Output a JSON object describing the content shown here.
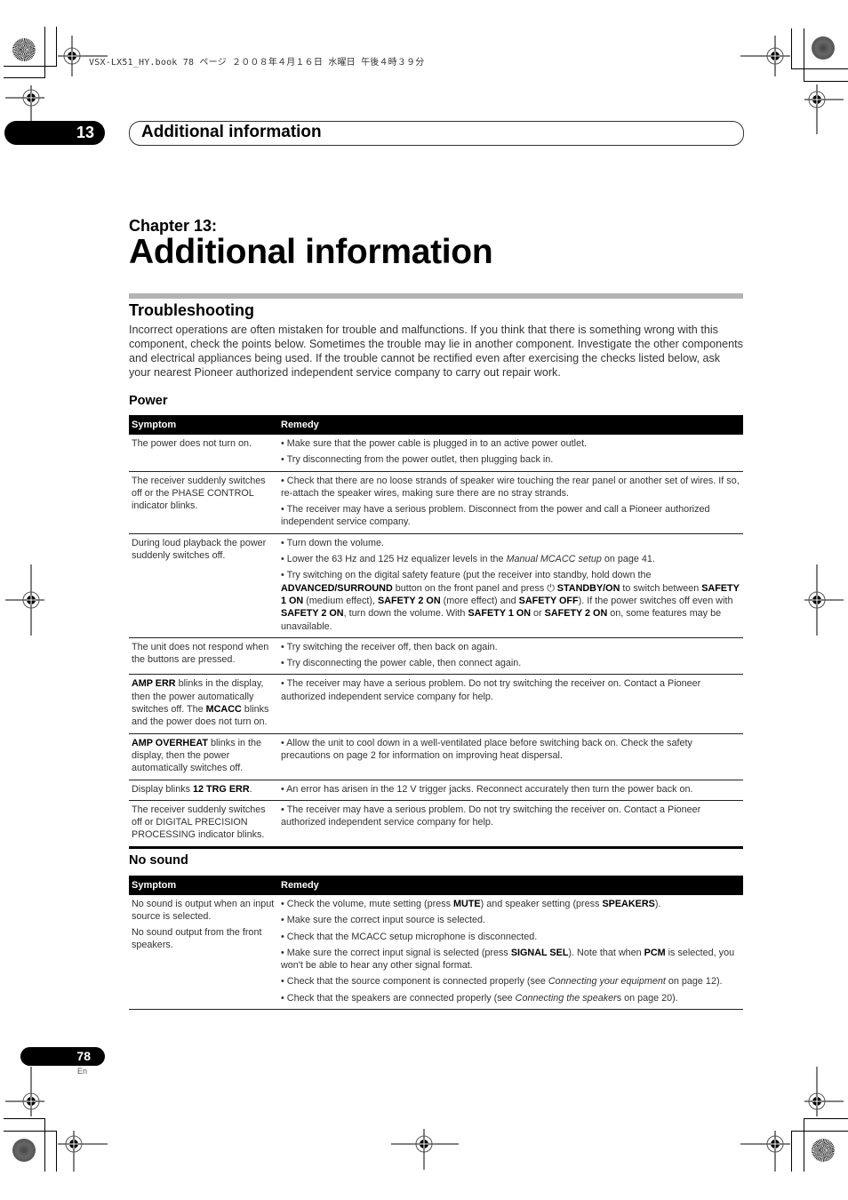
{
  "file_meta": "VSX-LX51_HY.book  78 ページ  ２００８年４月１６日  水曜日  午後４時３９分",
  "header": {
    "chapter_number": "13",
    "section_label": "Additional information"
  },
  "chapter": {
    "label": "Chapter 13:",
    "title": "Additional information"
  },
  "troubleshooting": {
    "title": "Troubleshooting",
    "intro": "Incorrect operations are often mistaken for trouble and malfunctions. If you think that there is something wrong with this component, check the points below. Sometimes the trouble may lie in another component. Investigate the other components and electrical appliances being used. If the trouble cannot be rectified even after exercising the checks listed below, ask your nearest Pioneer authorized independent service company to carry out repair work."
  },
  "power": {
    "title": "Power",
    "columns": [
      "Symptom",
      "Remedy"
    ],
    "rows": [
      {
        "symptom": [
          "The power does not turn on."
        ],
        "remedy": [
          "• Make sure that the power cable is plugged in to an active power outlet.",
          "• Try disconnecting from the power outlet, then plugging back in."
        ]
      },
      {
        "symptom": [
          "The receiver suddenly switches off or the PHASE CONTROL indicator blinks."
        ],
        "remedy": [
          "• Check that there are no loose strands of speaker wire touching the rear panel or another set of wires. If so, re-attach the speaker wires, making sure there are no stray strands.",
          "• The receiver may have a serious problem. Disconnect from the power and call a Pioneer authorized independent service company."
        ]
      },
      {
        "symptom": [
          "During loud playback the power suddenly switches off."
        ],
        "remedy": [
          "• Turn down the volume.",
          "• Lower the 63 Hz and 125 Hz equalizer levels in the <i>Manual MCACC setup</i> on page 41.",
          "• Try switching on the digital safety feature (put the receiver into standby, hold down the <b>ADVANCED/SURROUND</b> button on the front panel and press ⏻ <b>STANDBY/ON</b> to switch between <b>SAFETY 1 ON</b> (medium effect), <b>SAFETY 2 ON</b> (more effect) and <b>SAFETY OFF</b>). If the power switches off even with <b>SAFETY 2 ON</b>, turn down the volume. With <b>SAFETY 1 ON</b> or <b>SAFETY 2 ON</b> on, some features may be unavailable."
        ]
      },
      {
        "symptom": [
          "The unit does not respond when the buttons are pressed."
        ],
        "remedy": [
          "• Try switching the receiver off, then back on again.",
          "• Try disconnecting the power cable, then connect again."
        ]
      },
      {
        "symptom": [
          "<b>AMP ERR</b> blinks in the display, then the power automatically switches off. The <b>MCACC</b> blinks and the power does not turn on."
        ],
        "remedy": [
          "• The receiver may have a serious problem. Do not try switching the receiver on. Contact a Pioneer authorized independent service company for help."
        ]
      },
      {
        "symptom": [
          "<b>AMP OVERHEAT</b> blinks in the display, then the power automatically switches off."
        ],
        "remedy": [
          "• Allow the unit to cool down in a well-ventilated place before switching back on. Check the safety precautions on page 2 for information on improving heat dispersal."
        ]
      },
      {
        "symptom": [
          "Display blinks <b>12 TRG ERR</b>."
        ],
        "remedy": [
          "• An error has arisen in the 12 V trigger jacks. Reconnect accurately then turn the power back on."
        ]
      },
      {
        "symptom": [
          "The receiver suddenly switches off or DIGITAL PRECISION PROCESSING indicator blinks."
        ],
        "remedy": [
          "• The receiver may have a serious problem. Do not try switching the receiver on. Contact a Pioneer authorized independent service company for help."
        ]
      }
    ]
  },
  "no_sound": {
    "title": "No sound",
    "columns": [
      "Symptom",
      "Remedy"
    ],
    "rows": [
      {
        "symptom": [
          "No sound is output when an input source is selected.",
          "No sound output from the front speakers."
        ],
        "remedy": [
          "• Check the volume, mute setting (press <b>MUTE</b>) and speaker setting (press <b>SPEAKERS</b>).",
          "• Make sure the correct input source is selected.",
          "• Check that the MCACC setup microphone is disconnected.",
          "• Make sure the correct input signal is selected (press <b>SIGNAL SEL</b>). Note that when <b>PCM</b> is selected, you won't be able to hear any other signal format.",
          "• Check that the source component is connected properly (see <i>Connecting your equipment</i> on page 12).",
          "• Check that the speakers are connected properly (see <i>Connecting the speaker</i>s on page 20)."
        ]
      }
    ]
  },
  "footer": {
    "page_number": "78",
    "language": "En"
  }
}
